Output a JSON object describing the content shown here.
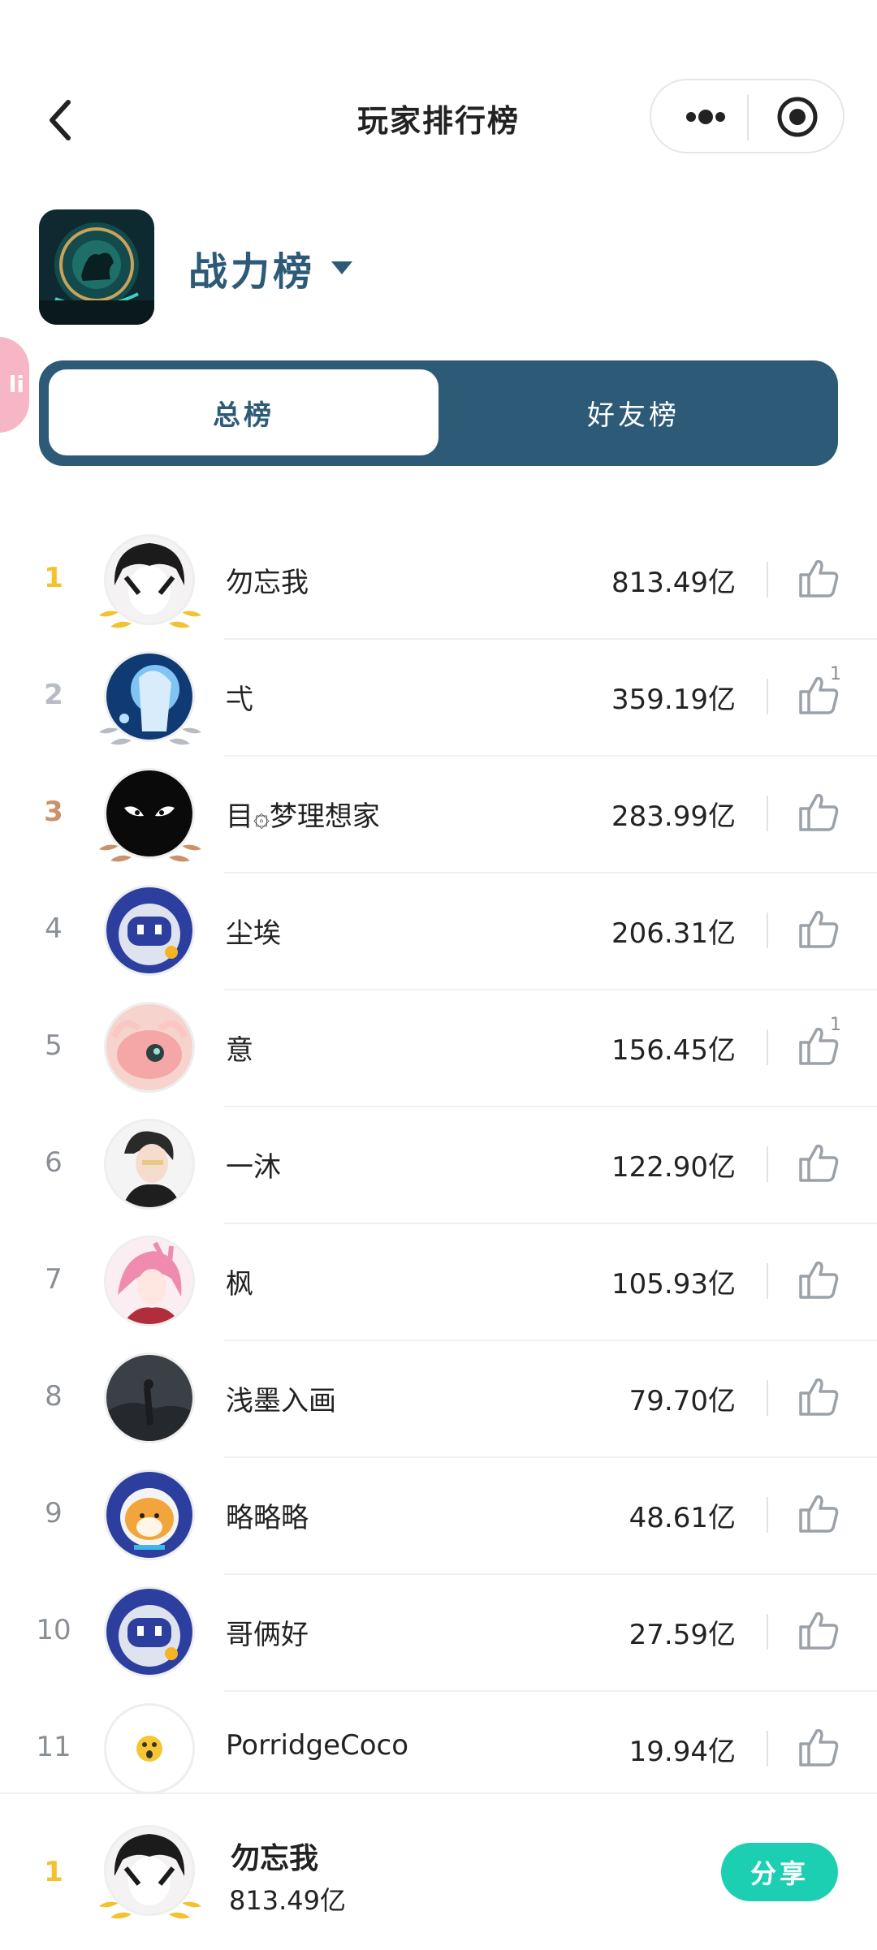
{
  "header": {
    "title": "玩家排行榜"
  },
  "board": {
    "title": "战力榜",
    "side_badge": "li"
  },
  "tabs": [
    {
      "label": "总榜",
      "active": true
    },
    {
      "label": "好友榜",
      "active": false
    }
  ],
  "colors": {
    "primary": "#2d5b77",
    "accent": "#1ccfb3",
    "gold": "#f2c230",
    "silver": "#b7bcc3",
    "bronze": "#c9926a"
  },
  "rankings": [
    {
      "rank": "1",
      "name": "勿忘我",
      "power": "813.49亿",
      "likes": ""
    },
    {
      "rank": "2",
      "name": "弌",
      "power": "359.19亿",
      "likes": "1"
    },
    {
      "rank": "3",
      "name": "目۞梦理想家",
      "power": "283.99亿",
      "likes": ""
    },
    {
      "rank": "4",
      "name": "尘埃",
      "power": "206.31亿",
      "likes": ""
    },
    {
      "rank": "5",
      "name": "意",
      "power": "156.45亿",
      "likes": "1"
    },
    {
      "rank": "6",
      "name": "一沐",
      "power": "122.90亿",
      "likes": ""
    },
    {
      "rank": "7",
      "name": "枫",
      "power": "105.93亿",
      "likes": ""
    },
    {
      "rank": "8",
      "name": "浅墨入画",
      "power": "79.70亿",
      "likes": ""
    },
    {
      "rank": "9",
      "name": "略略略",
      "power": "48.61亿",
      "likes": ""
    },
    {
      "rank": "10",
      "name": "哥俩好",
      "power": "27.59亿",
      "likes": ""
    },
    {
      "rank": "11",
      "name": "PorridgeCoco",
      "power": "19.94亿",
      "likes": ""
    }
  ],
  "me": {
    "rank": "1",
    "name": "勿忘我",
    "power": "813.49亿",
    "share_label": "分享"
  }
}
